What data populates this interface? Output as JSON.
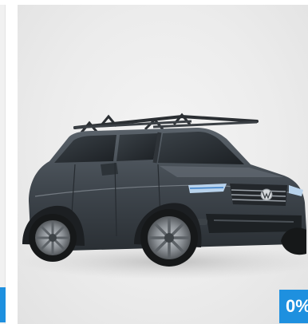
{
  "carousel": {
    "current_card": {
      "image_subject": "car-photo",
      "badge_text": "0%",
      "badge_color": "#1e90df"
    },
    "previous_card": {
      "badge_color": "#1e90df"
    }
  }
}
